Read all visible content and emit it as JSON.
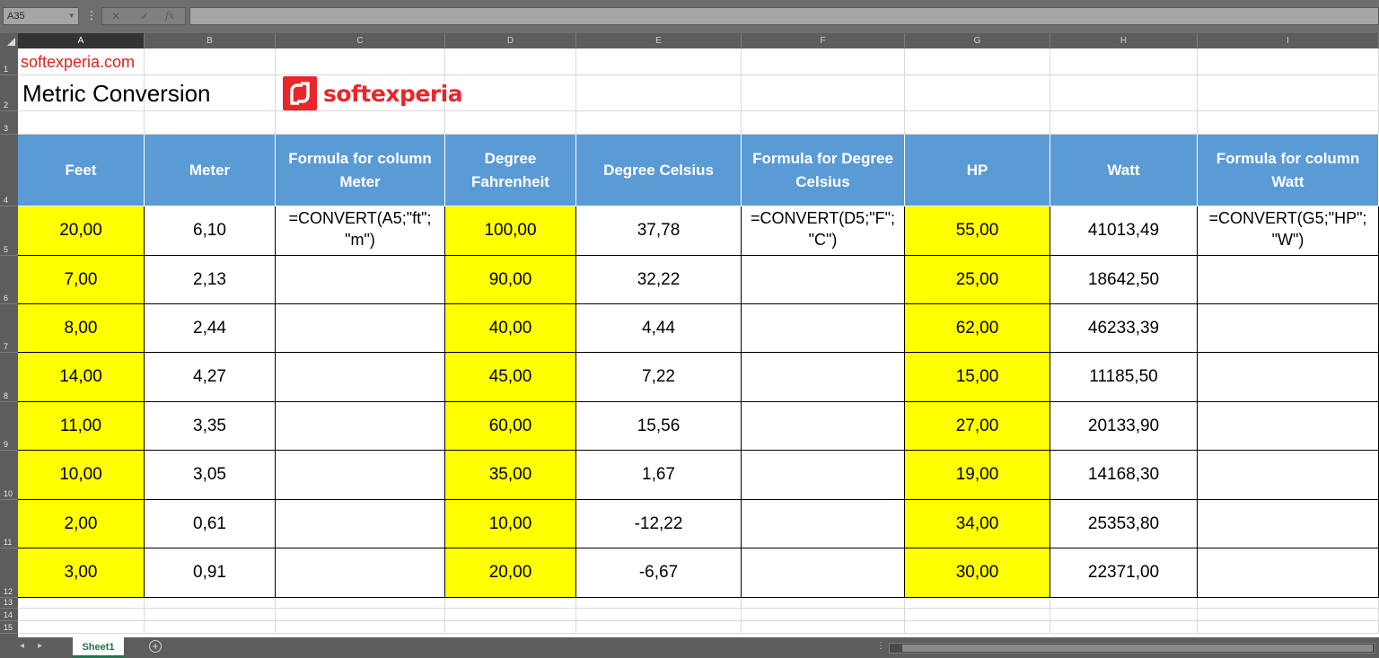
{
  "formula_bar": {
    "name_box": "A35",
    "fx_label": "fx",
    "cancel": "✕",
    "enter": "✓"
  },
  "columns": [
    "A",
    "B",
    "C",
    "D",
    "E",
    "F",
    "G",
    "H",
    "I"
  ],
  "rows": [
    "1",
    "2",
    "3",
    "4",
    "5",
    "6",
    "7",
    "8",
    "9",
    "10",
    "11",
    "12",
    "13",
    "14",
    "15"
  ],
  "site": "softexperia.com",
  "title": "Metric Conversion",
  "logo_text": "softexperia",
  "headers": [
    "Feet",
    "Meter",
    "Formula for column Meter",
    "Degree Fahrenheit",
    "Degree Celsius",
    "Formula for Degree Celsius",
    "HP",
    "Watt",
    "Formula for column Watt"
  ],
  "formulas": {
    "meter": "=CONVERT(A5;\"ft\";\n\"m\")",
    "celsius": "=CONVERT(D5;\"F\";\n\"C\")",
    "watt": "=CONVERT(G5;\"HP\";\n\"W\")"
  },
  "data": {
    "feet": [
      "20,00",
      "7,00",
      "8,00",
      "14,00",
      "11,00",
      "10,00",
      "2,00",
      "3,00"
    ],
    "meter": [
      "6,10",
      "2,13",
      "2,44",
      "4,27",
      "3,35",
      "3,05",
      "0,61",
      "0,91"
    ],
    "fahrenheit": [
      "100,00",
      "90,00",
      "40,00",
      "45,00",
      "60,00",
      "35,00",
      "10,00",
      "20,00"
    ],
    "celsius": [
      "37,78",
      "32,22",
      "4,44",
      "7,22",
      "15,56",
      "1,67",
      "-12,22",
      "-6,67"
    ],
    "hp": [
      "55,00",
      "25,00",
      "62,00",
      "15,00",
      "27,00",
      "19,00",
      "34,00",
      "30,00"
    ],
    "watt": [
      "41013,49",
      "18642,50",
      "46233,39",
      "11185,50",
      "20133,90",
      "14168,30",
      "25353,80",
      "22371,00"
    ]
  },
  "sheet_tab": "Sheet1",
  "colors": {
    "header_blue": "#5b9bd5",
    "highlight_yellow": "#ffff00",
    "brand_red": "#e8262c"
  }
}
